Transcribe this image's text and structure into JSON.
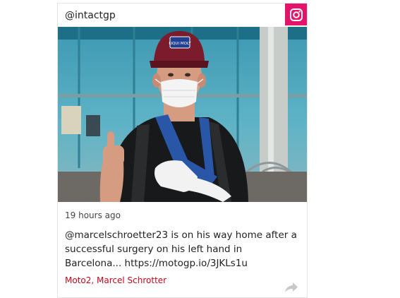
{
  "post": {
    "handle": "@intactgp",
    "platform_icon": "instagram-icon",
    "timestamp": "19 hours ago",
    "caption": "@marcelschroetter23 is on his way home after a successful surgery on his left hand in Barcelona... https://motogp.io/3JKLs1u",
    "tags": [
      "Moto2",
      "Marcel Schrotter"
    ],
    "tag_separator": ", ",
    "cap_logo_text": "LIQUI MOLY",
    "colors": {
      "instagram_badge": "#e3136a",
      "tag_link": "#c0081a"
    }
  }
}
